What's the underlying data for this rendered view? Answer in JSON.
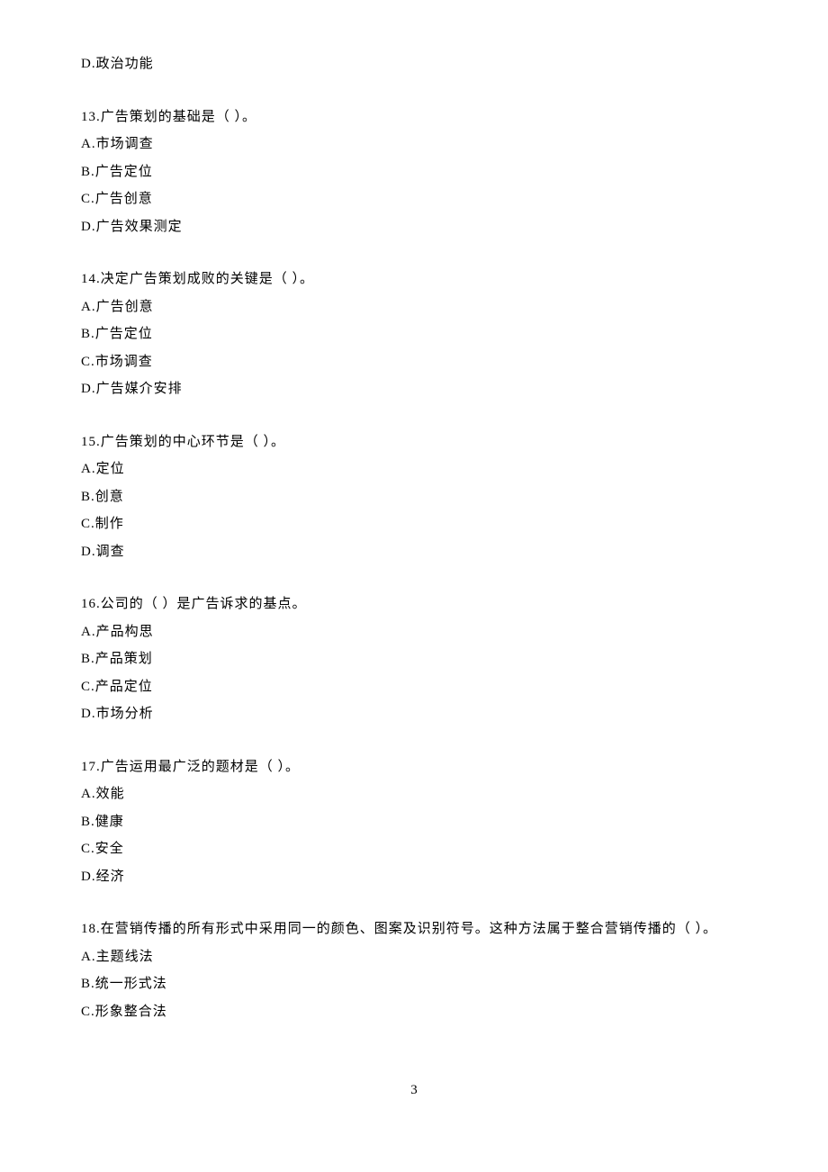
{
  "orphan_option": "D.政治功能",
  "questions": [
    {
      "stem": "13.广告策划的基础是（  ）。",
      "opts": [
        "A.市场调查",
        "B.广告定位",
        "C.广告创意",
        "D.广告效果测定"
      ]
    },
    {
      "stem": "14.决定广告策划成败的关键是（  ）。",
      "opts": [
        "A.广告创意",
        "B.广告定位",
        "C.市场调查",
        "D.广告媒介安排"
      ]
    },
    {
      "stem": "15.广告策划的中心环节是（  ）。",
      "opts": [
        "A.定位",
        "B.创意",
        "C.制作",
        "D.调查"
      ]
    },
    {
      "stem": "16.公司的（  ）是广告诉求的基点。",
      "opts": [
        "A.产品构思",
        "B.产品策划",
        "C.产品定位",
        "D.市场分析"
      ]
    },
    {
      "stem": "17.广告运用最广泛的题材是（  ）。",
      "opts": [
        "A.效能",
        "B.健康",
        "C.安全",
        "D.经济"
      ]
    },
    {
      "stem": "18.在营销传播的所有形式中采用同一的颜色、图案及识别符号。这种方法属于整合营销传播的（  ）。",
      "opts": [
        "A.主题线法",
        "B.统一形式法",
        "C.形象整合法"
      ]
    }
  ],
  "page_number": "3"
}
